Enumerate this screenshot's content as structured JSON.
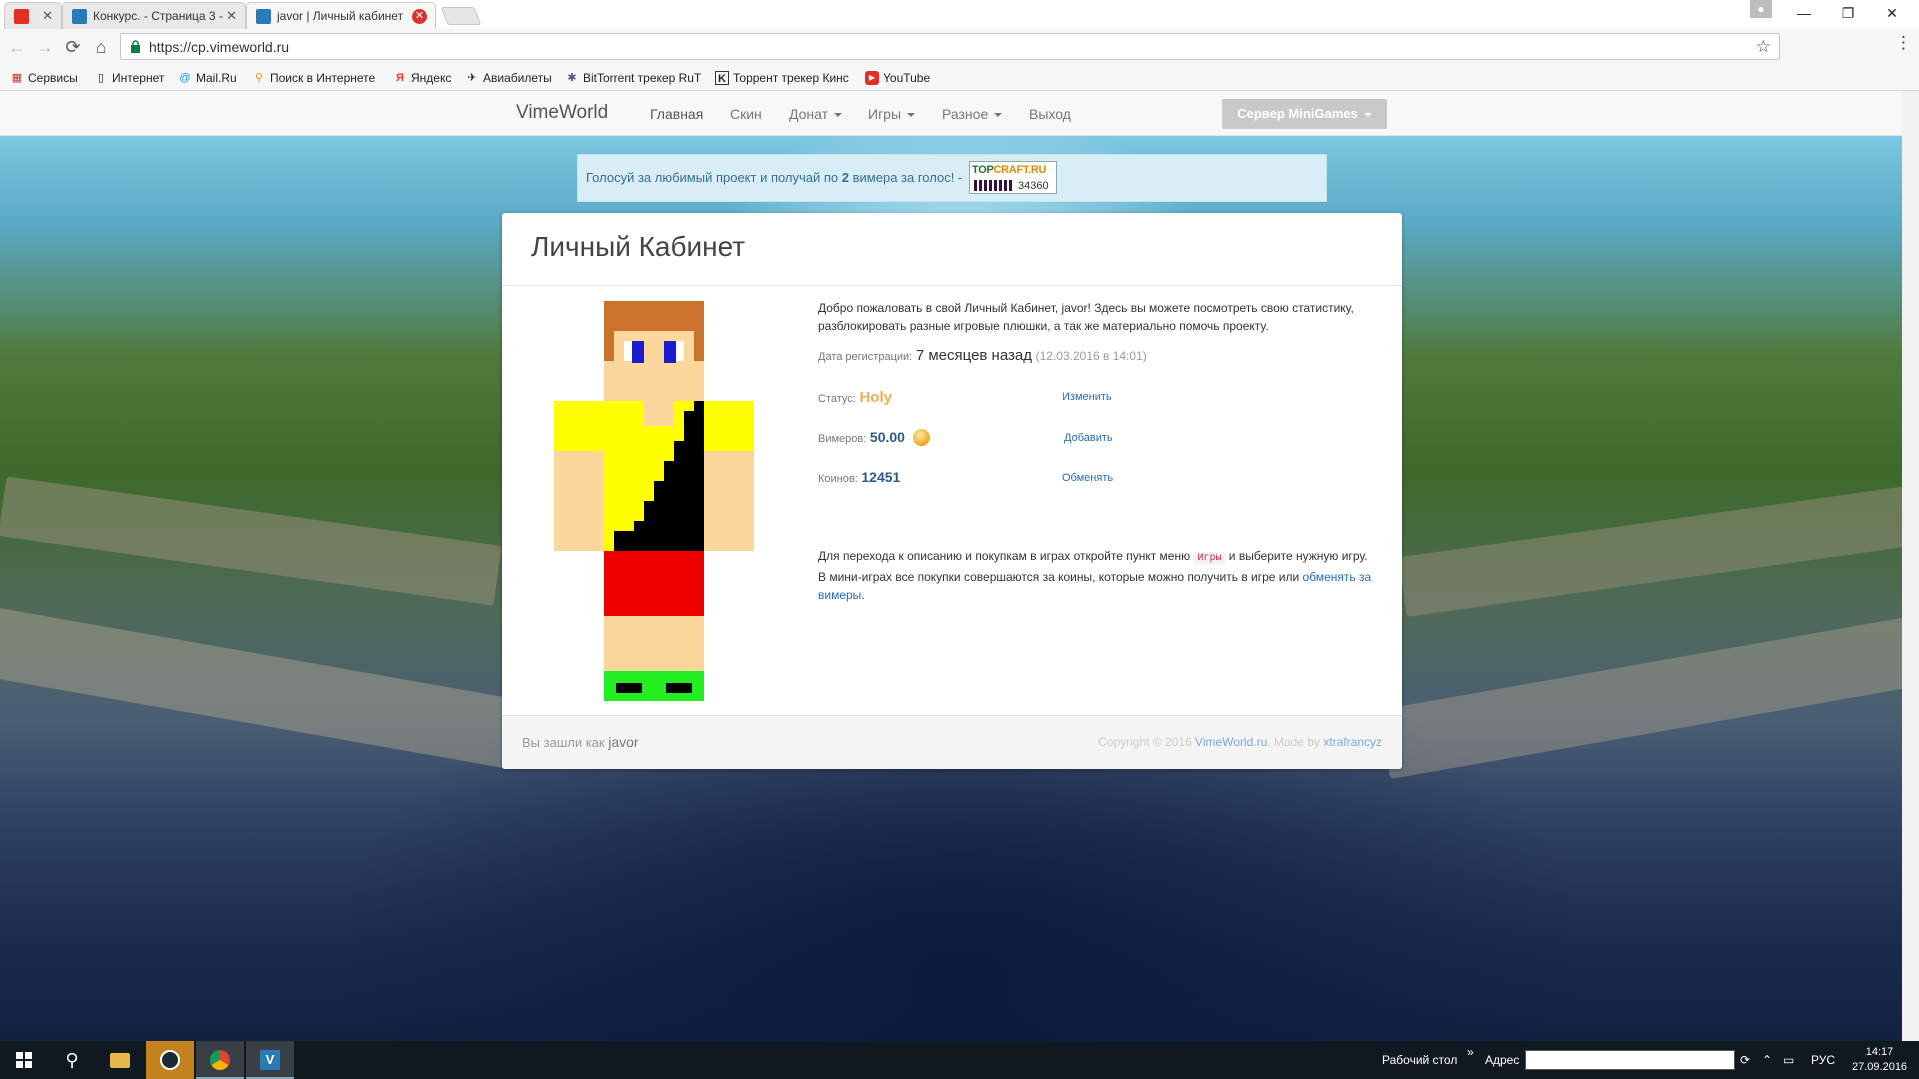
{
  "browser": {
    "tabs": [
      {
        "label": "",
        "kind": "youtube"
      },
      {
        "label": "Конкурс. - Страница 3 -",
        "kind": "vimeworld"
      },
      {
        "label": "javor | Личный кабинет",
        "kind": "vimeworld",
        "active": true
      }
    ],
    "url": "https://cp.vimeworld.ru",
    "bookmarks": [
      {
        "label": "Сервисы",
        "icon": "apps-icon"
      },
      {
        "label": "Интернет",
        "icon": "page-icon"
      },
      {
        "label": "Mail.Ru",
        "icon": "mailru-icon"
      },
      {
        "label": "Поиск в Интернете",
        "icon": "search-web-icon"
      },
      {
        "label": "Яндекс",
        "icon": "yandex-icon"
      },
      {
        "label": "Авиабилеты",
        "icon": "plane-icon"
      },
      {
        "label": "BitTorrent трекер RuT",
        "icon": "torrent-icon"
      },
      {
        "label": "Торрент трекер Кинс",
        "icon": "kinozal-icon"
      },
      {
        "label": "YouTube",
        "icon": "youtube-icon"
      }
    ]
  },
  "site": {
    "brand": "VimeWorld",
    "nav": [
      {
        "label": "Главная",
        "active": true
      },
      {
        "label": "Скин"
      },
      {
        "label": "Донат",
        "dropdown": true
      },
      {
        "label": "Игры",
        "dropdown": true
      },
      {
        "label": "Разное",
        "dropdown": true
      },
      {
        "label": "Выход"
      }
    ],
    "server_button": "Сервер MiniGames",
    "vote": {
      "text_before": "Голосуй за любимый проект и получай по ",
      "amount": "2",
      "text_after": " вимера за голос! -",
      "badge_logo_a": "TOP",
      "badge_logo_b": "CRAFT.RU",
      "badge_count": "34360"
    }
  },
  "panel": {
    "title": "Личный Кабинет",
    "welcome": "Добро пожаловать в свой Личный Кабинет, javor! Здесь вы можете посмотреть свою статистику, разблокировать разные игровые плюшки, а так же материально помочь проекту.",
    "registration": {
      "label": "Дата регистрации:",
      "value": "7 месяцев назад",
      "date": "(12.03.2016 в 14:01)"
    },
    "status": {
      "label": "Статус:",
      "value": "Holy",
      "action": "Изменить"
    },
    "vimers": {
      "label": "Вимеров:",
      "value": "50.00",
      "action": "Добавить"
    },
    "coins": {
      "label": "Коинов:",
      "value": "12451",
      "action": "Обменять"
    },
    "howto": {
      "part1": "Для перехода к описанию и покупкам в играх откройте пункт меню ",
      "code": "Игры",
      "part2": " и выберите нужную игру. В мини-играх все покупки совершаются за коины, которые можно получить в игре или ",
      "link": "обменять за вимеры",
      "part3": "."
    },
    "footer": {
      "logged_prefix": "Вы зашли как ",
      "username": "javor",
      "copyright_prefix": "Copyright © 2016 ",
      "copyright_site": "VimeWorld.ru",
      "copyright_mid": ". Made by ",
      "copyright_author": "xtrafrancyz"
    }
  },
  "taskbar": {
    "desktop_label": "Рабочий стол",
    "address_label": "Адрес",
    "language": "РУС",
    "time": "14:17",
    "date": "27.09.2016"
  },
  "colors": {
    "status_holy": "#f0ad4e",
    "link": "#2a6ac0",
    "alert_bg": "#d9edf7"
  }
}
